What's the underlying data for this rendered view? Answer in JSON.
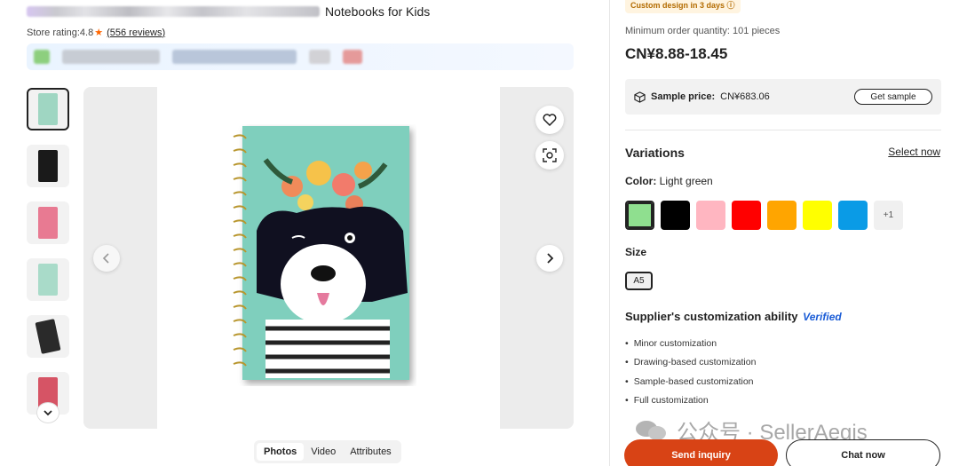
{
  "product": {
    "title_suffix": "Notebooks for Kids",
    "store_rating_label": "Store rating:",
    "store_rating_value": "4.8",
    "reviews_link": "(556 reviews)"
  },
  "media_tabs": [
    "Photos",
    "Video",
    "Attributes"
  ],
  "right": {
    "badge": "Custom design in 3 days ⓘ",
    "moq": "Minimum order quantity: 101 pieces",
    "price": "CN¥8.88-18.45",
    "sample_label": "Sample price:",
    "sample_value": "CN¥683.06",
    "get_sample": "Get sample",
    "variations_title": "Variations",
    "select_now": "Select now",
    "color_key": "Color:",
    "color_value": "Light green",
    "colors": [
      "#8fdf8f",
      "#000000",
      "#ffb6c1",
      "#ff0000",
      "#ffa500",
      "#ffff00",
      "#0a9be6"
    ],
    "more_colors": "+1",
    "size_title": "Size",
    "size_value": "A5",
    "custom_title": "Supplier's customization ability",
    "verified": "Verified",
    "custom_items": [
      "Minor customization",
      "Drawing-based customization",
      "Sample-based customization",
      "Full customization"
    ]
  },
  "actions": {
    "send_inquiry": "Send inquiry",
    "chat_now": "Chat now"
  },
  "watermark": "公众号 · SellerAegis"
}
